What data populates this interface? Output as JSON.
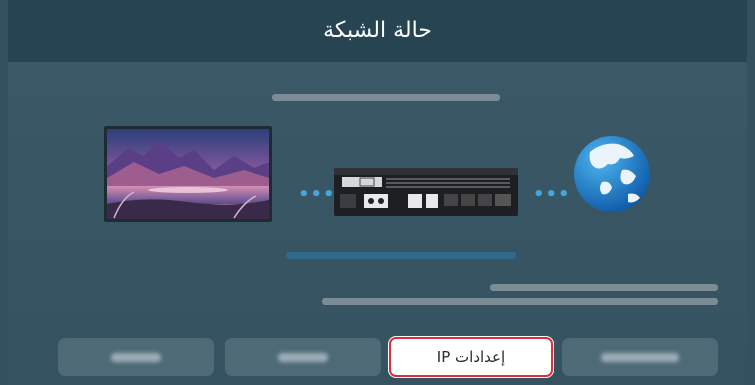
{
  "header": {
    "title": "حالة الشبكة"
  },
  "buttons": [
    {
      "id": "btn-1",
      "label": ""
    },
    {
      "id": "btn-2",
      "label": ""
    },
    {
      "id": "btn-ip",
      "label": "إعدادات IP"
    },
    {
      "id": "btn-4",
      "label": ""
    }
  ],
  "diagram": {
    "nodes": [
      "tv-screen",
      "network-device",
      "internet-globe"
    ],
    "connection_color": "#47a3dc"
  },
  "colors": {
    "background": "#33515f",
    "header": "#274452",
    "focus_border": "#d6303a",
    "accent": "#47a3dc"
  }
}
